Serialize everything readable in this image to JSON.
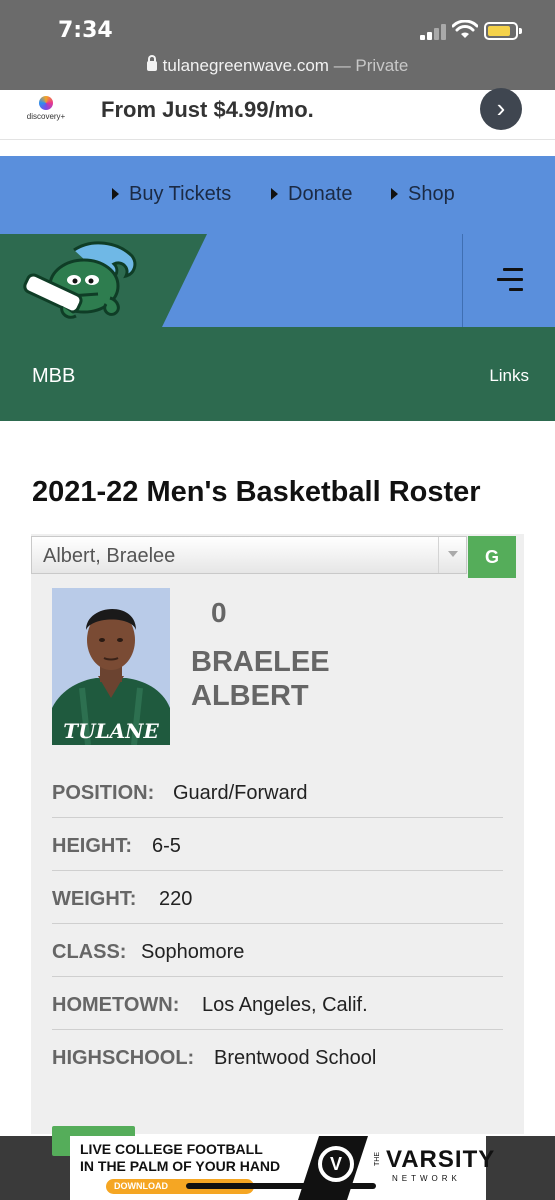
{
  "status_bar": {
    "time": "7:34"
  },
  "browser": {
    "domain": "tulanegreenwave.com",
    "mode": "— Private"
  },
  "ad": {
    "brand": "discovery+",
    "headline": "From Just $4.99/mo."
  },
  "utility_nav": [
    {
      "label": "Buy Tickets"
    },
    {
      "label": "Donate"
    },
    {
      "label": "Shop"
    }
  ],
  "section_nav": {
    "sport": "MBB",
    "links_label": "Links"
  },
  "roster": {
    "title": "2021-22 Men's Basketball Roster",
    "selected_player": "Albert, Braelee",
    "go_label": "G"
  },
  "player": {
    "number": "0",
    "first_name": "BRAELEE",
    "last_name": "ALBERT",
    "jersey_text": "TULANE",
    "attributes": [
      {
        "label": "POSITION:",
        "value": "Guard/Forward"
      },
      {
        "label": "HEIGHT:",
        "value": "6-5"
      },
      {
        "label": "WEIGHT:",
        "value": "220"
      },
      {
        "label": "CLASS:",
        "value": "Sophomore"
      },
      {
        "label": "HOMETOWN:",
        "value": "Los Angeles, Calif."
      },
      {
        "label": "HIGHSCHOOL:",
        "value": "Brentwood School"
      }
    ]
  },
  "bottom_ad": {
    "line1": "LIVE COLLEGE FOOTBALL",
    "line2": "IN THE PALM OF YOUR HAND",
    "cta": "DOWNLOAD",
    "the": "THE",
    "brand": "VARSITY",
    "network": "NETWORK"
  },
  "colors": {
    "green": "#2d6a4f",
    "blue": "#5a8fdc",
    "button_green": "#55ad5a"
  }
}
